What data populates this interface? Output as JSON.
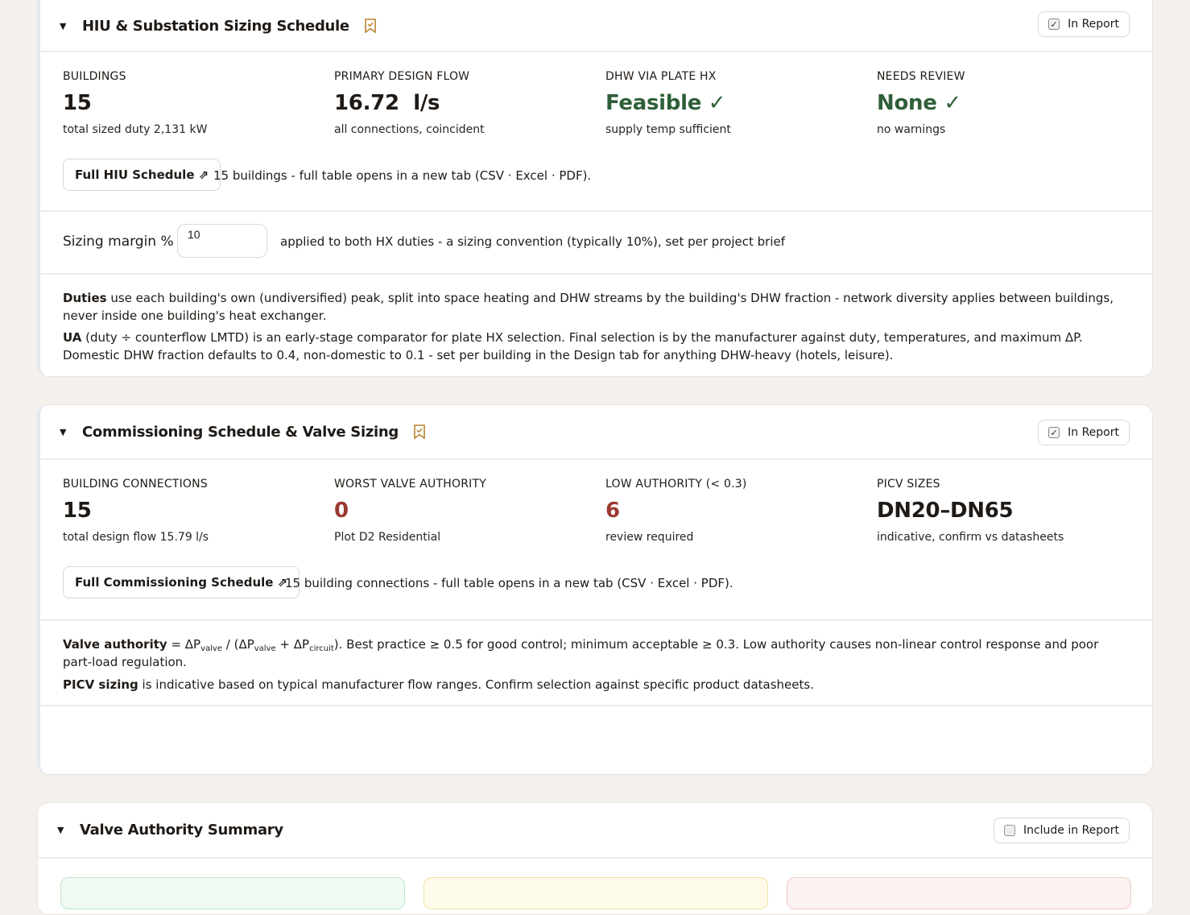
{
  "hiu": {
    "title": "HIU & Substation Sizing Schedule",
    "report_label": "In Report",
    "stats": [
      {
        "label": "BUILDINGS",
        "value": "15",
        "sub": "total sized duty 2,131 kW"
      },
      {
        "label": "PRIMARY DESIGN FLOW",
        "value": "16.72  l/s",
        "sub": "all connections, coincident"
      },
      {
        "label": "DHW VIA PLATE HX",
        "value": "Feasible ✓",
        "sub": "supply temp sufficient"
      },
      {
        "label": "NEEDS REVIEW",
        "value": "None ✓",
        "sub": "no warnings"
      }
    ],
    "button": "Full HIU Schedule ⇗",
    "button_note": "15 buildings - full table opens in a new tab (CSV · Excel · PDF).",
    "margin_label": "Sizing margin %",
    "margin_value": "10",
    "margin_note": "applied to both HX duties - a sizing convention (typically 10%), set per project brief",
    "note1_bold": "Duties",
    "note1_text": " use each building's own (undiversified) peak, split into space heating and DHW streams by the building's DHW fraction - network diversity applies between buildings, never inside one building's heat exchanger.",
    "note2_bold": "UA",
    "note2_text": " (duty ÷ counterflow LMTD) is an early-stage comparator for plate HX selection. Final selection is by the manufacturer against duty, temperatures, and maximum ΔP. Domestic DHW fraction defaults to 0.4, non-domestic to 0.1 - set per building in the Design tab for anything DHW-heavy (hotels, leisure)."
  },
  "commissioning": {
    "title": "Commissioning Schedule & Valve Sizing",
    "report_label": "In Report",
    "stats": [
      {
        "label": "BUILDING CONNECTIONS",
        "value": "15",
        "sub": "total design flow 15.79 l/s"
      },
      {
        "label": "WORST VALVE AUTHORITY",
        "value": "0",
        "sub": "Plot D2 Residential"
      },
      {
        "label": "LOW AUTHORITY (< 0.3)",
        "value": "6",
        "sub": "review required"
      },
      {
        "label": "PICV SIZES",
        "value": "DN20–DN65",
        "sub": "indicative, confirm vs datasheets"
      }
    ],
    "button": "Full Commissioning Schedule ⇗",
    "button_note": "15 building connections - full table opens in a new tab (CSV · Excel · PDF).",
    "va_bold": "Valve authority",
    "va_eq": " = ΔP",
    "va_sub1": "valve",
    "va_mid": " / (ΔP",
    "va_sub2": "valve",
    "va_plus": " + ΔP",
    "va_sub3": "circuit",
    "va_rest": "). Best practice ≥ 0.5 for good control; minimum acceptable ≥ 0.3. Low authority causes non-linear control response and poor part-load regulation.",
    "picv_bold": "PICV sizing",
    "picv_text": " is indicative based on typical manufacturer flow ranges. Confirm selection against specific product datasheets."
  },
  "valve_summary": {
    "title": "Valve Authority Summary",
    "report_label": "Include in Report"
  },
  "colors": {
    "good": "#2f5f38",
    "bad": "#9a3a32",
    "bookmark": "#b8842c"
  }
}
